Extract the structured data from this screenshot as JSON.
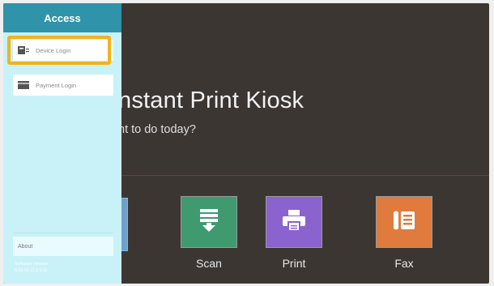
{
  "kiosk": {
    "title": "nstant Print Kiosk",
    "subtitle": "nt to do today?"
  },
  "tiles": [
    {
      "label": "Scan",
      "icon": "scan-icon",
      "color": "#3f9a6f"
    },
    {
      "label": "Print",
      "icon": "printer-icon",
      "color": "#8a63cf"
    },
    {
      "label": "Fax",
      "icon": "fax-icon",
      "color": "#e07b3d"
    }
  ],
  "panel": {
    "header": "Access",
    "items": [
      {
        "label": "Device Login",
        "icon": "device-login-icon",
        "selected": true
      },
      {
        "label": "Payment Login",
        "icon": "payment-card-icon",
        "selected": false
      }
    ],
    "about_label": "About",
    "footer_lines": [
      "Software Version",
      "0.01.01 (1.0.0.0)"
    ]
  },
  "colors": {
    "panel_background": "#c8f2f7",
    "panel_header": "#2f93a9",
    "selection_outline": "#f3b21c",
    "screen_background": "#3c3632"
  }
}
